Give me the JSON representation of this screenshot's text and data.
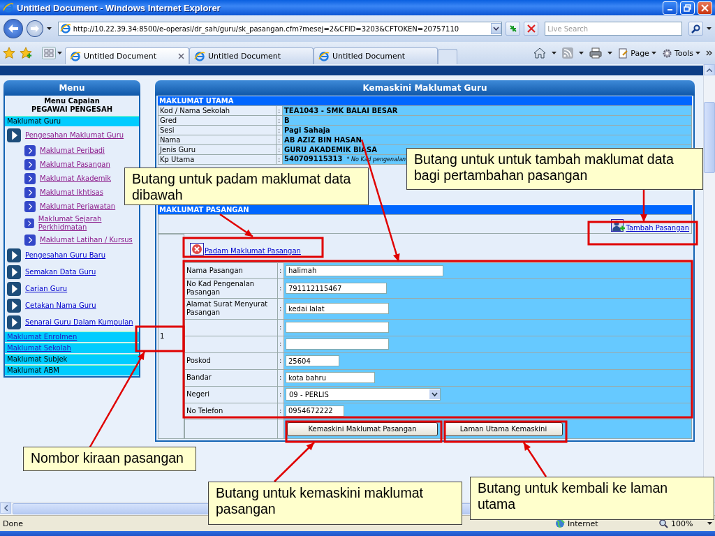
{
  "window": {
    "title": "Untitled Document - Windows Internet Explorer"
  },
  "address_bar": {
    "url": "http://10.22.39.34:8500/e-operasi/dr_sah/guru/sk_pasangan.cfm?mesej=2&CFID=3203&CFTOKEN=20757110",
    "search_placeholder": "Live Search"
  },
  "tabs": [
    {
      "label": "Untitled Document",
      "selected": true
    },
    {
      "label": "Untitled Document",
      "selected": false
    },
    {
      "label": "Untitled Document",
      "selected": false
    }
  ],
  "commands": [
    {
      "label": "Page"
    },
    {
      "label": "Tools"
    }
  ],
  "menu": {
    "title": "Menu",
    "heading_1": "Menu Capaian",
    "heading_2": "PEGAWAI PENGESAH",
    "sections": [
      {
        "label": "Maklumat Guru",
        "link": false,
        "items": [
          {
            "label": "Pengesahan Maklumat Guru",
            "visited": true,
            "children": [
              {
                "label": "Maklumat Peribadi",
                "visited": true
              },
              {
                "label": "Maklumat Pasangan",
                "visited": true
              },
              {
                "label": "Maklumat Akademik",
                "visited": true
              },
              {
                "label": "Maklumat Ikhtisas",
                "visited": true
              },
              {
                "label": "Maklumat Perjawatan",
                "visited": true
              },
              {
                "label": "Maklumat Sejarah Perkhidmatan",
                "visited": true
              },
              {
                "label": "Maklumat Latihan / Kursus",
                "visited": true
              }
            ]
          },
          {
            "label": "Pengesahan Guru Baru",
            "visited": false
          },
          {
            "label": "Semakan Data Guru",
            "visited": false
          },
          {
            "label": "Carian Guru",
            "visited": false
          },
          {
            "label": "Cetakan Nama Guru",
            "visited": false
          },
          {
            "label": "Senarai Guru Dalam Kumpulan",
            "visited": false
          }
        ]
      },
      {
        "label": "Maklumat Enrolmen",
        "link": true
      },
      {
        "label": "Maklumat Sekolah",
        "link": true
      },
      {
        "label": "Maklumat Subjek",
        "link": false
      },
      {
        "label": "Maklumat ABM",
        "link": false
      }
    ]
  },
  "main": {
    "title": "Kemaskini Maklumat Guru",
    "section_title": "MAKLUMAT UTAMA",
    "fields": [
      {
        "label": "Kod / Nama Sekolah",
        "separator": ":",
        "value": "TEA1043 - SMK BALAI BESAR"
      },
      {
        "label": "Gred",
        "separator": ":",
        "value": "B"
      },
      {
        "label": "Sesi",
        "separator": ":",
        "value": "Pagi Sahaja"
      },
      {
        "label": "Nama",
        "separator": ":",
        "value": "AB AZIZ BIN HASAN"
      },
      {
        "label": "Jenis Guru",
        "separator": ":",
        "value": "GURU AKADEMIK BIASA"
      },
      {
        "label": "Kp Utama",
        "separator": ":",
        "value": "540709115313",
        "note": "* No Kad pengenalan"
      }
    ],
    "spouse": {
      "section_title": "MAKLUMAT PASANGAN",
      "add_link": "Tambah Pasangan",
      "entries": [
        {
          "number": "1",
          "delete_link": "Padam Maklumat Pasangan",
          "fields": [
            {
              "kind": "text",
              "label": "Nama Pasangan",
              "separator": ":",
              "value": "halimah"
            },
            {
              "kind": "text",
              "label": "No Kad Pengenalan Pasangan",
              "separator": ":",
              "value": "791112115467"
            },
            {
              "kind": "text",
              "label": "Alamat Surat Menyurat Pasangan",
              "separator": ":",
              "value": "kedai lalat"
            },
            {
              "kind": "text",
              "separator": ":"
            },
            {
              "kind": "text",
              "separator": ":"
            },
            {
              "kind": "text",
              "label": "Poskod",
              "separator": ":",
              "value": "25604"
            },
            {
              "kind": "text",
              "label": "Bandar",
              "separator": ":",
              "value": "kota bahru"
            },
            {
              "kind": "select",
              "label": "Negeri",
              "separator": ":",
              "value": "09 - PERLIS"
            },
            {
              "kind": "text",
              "label": "No Telefon",
              "separator": ":",
              "value": "0954672222"
            }
          ]
        }
      ],
      "buttons": [
        "Kemaskini Maklumat Pasangan",
        "Laman Utama Kemaskini"
      ]
    }
  },
  "status_bar": {
    "status": "Done",
    "zone": "Internet",
    "zoom": "100%"
  },
  "annotations": [
    {
      "text": "Butang untuk untuk tambah maklumat data bagi pertambahan pasangan"
    },
    {
      "text": "Butang untuk padam maklumat data dibawah"
    },
    {
      "text": "Nombor kiraan pasangan"
    },
    {
      "text": "Butang untuk kemaskini maklumat pasangan"
    },
    {
      "text": "Butang untuk kembali ke laman utama"
    }
  ]
}
